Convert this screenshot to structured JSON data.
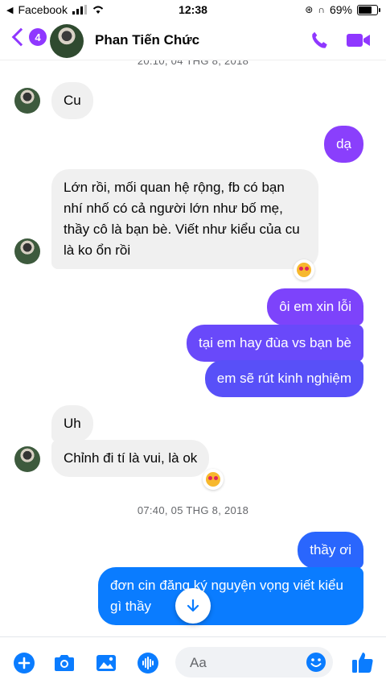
{
  "status_bar": {
    "back_app": "Facebook",
    "time": "12:38",
    "battery": "69%"
  },
  "header": {
    "unread_count": "4",
    "contact_name": "Phan Tiến Chức"
  },
  "colors": {
    "accent": "#8f37ff",
    "out_bubble_top": "#8a3ffc",
    "out_bubble_bottom": "#0a7cff",
    "in_bubble": "#f0f0f0"
  },
  "messages": {
    "top_timestamp": "20:10, 04 THG 8, 2018",
    "m1": "Cu",
    "m2": "dạ",
    "m3": "Lớn rồi, mối quan hệ rộng, fb có bạn nhí nhố có cả người lớn như bố mẹ, thầy cô là bạn bè. Viết như kiểu của cu là ko ổn rồi",
    "m4": "ôi em xin lỗi",
    "m5": "tại em hay đùa vs bạn bè",
    "m6": "em sẽ rút kinh nghiệm",
    "m7": "Uh",
    "m8": "Chỉnh đi tí là vui, là ok",
    "mid_timestamp": "07:40, 05 THG 8, 2018",
    "m9": "thầy ơi",
    "m10": "đơn cin đăng ký nguyện vọng viết kiểu gì thầy"
  },
  "composer": {
    "placeholder": "Aa"
  },
  "icons": [
    "back-chevron-icon",
    "phone-icon",
    "video-camera-icon",
    "plus-icon",
    "camera-icon",
    "image-icon",
    "microphone-icon",
    "smiley-icon",
    "thumbs-up-icon",
    "arrow-down-icon",
    "heart-eyes-emoji-icon"
  ]
}
